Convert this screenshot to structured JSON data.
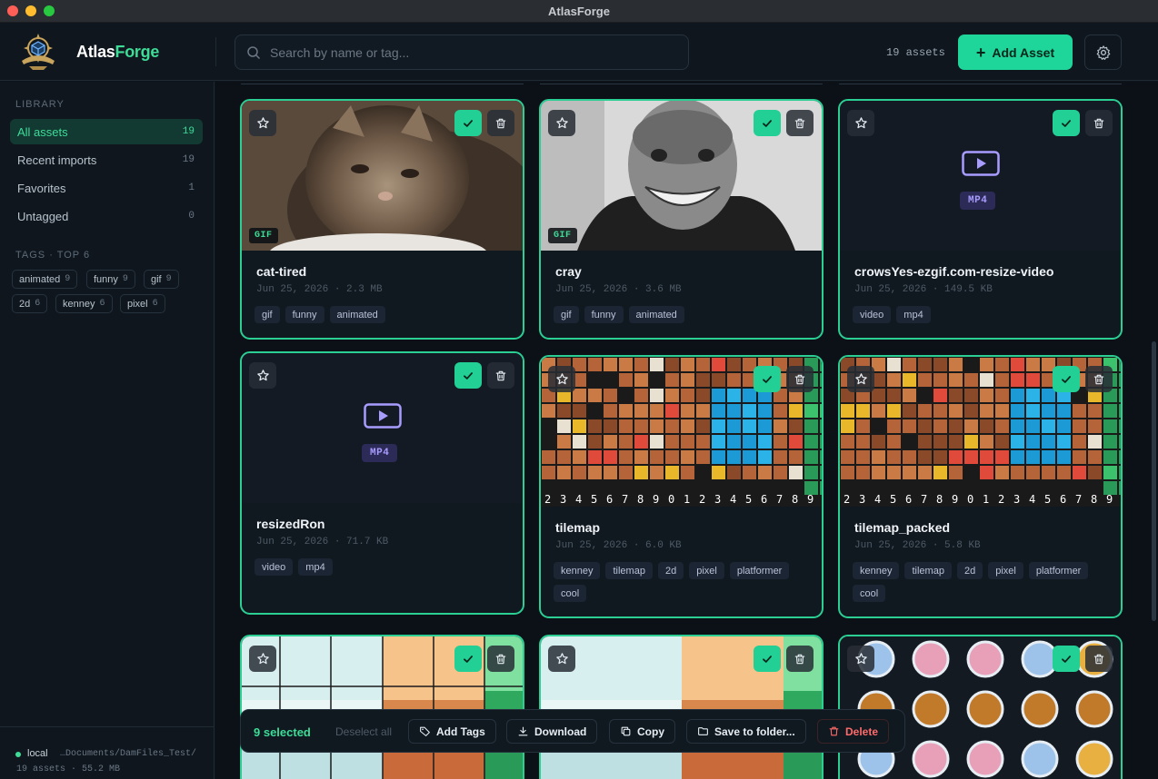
{
  "window": {
    "title": "AtlasForge"
  },
  "brand": {
    "part1": "Atlas",
    "part2": "Forge"
  },
  "search": {
    "placeholder": "Search by name or tag..."
  },
  "header": {
    "asset_count": "19 assets",
    "add_label": "Add Asset"
  },
  "sidebar": {
    "library_label": "LIBRARY",
    "items": [
      {
        "label": "All assets",
        "count": "19"
      },
      {
        "label": "Recent imports",
        "count": "19"
      },
      {
        "label": "Favorites",
        "count": "1"
      },
      {
        "label": "Untagged",
        "count": "0"
      }
    ],
    "tags_label": "TAGS · TOP 6",
    "tags": [
      {
        "label": "animated",
        "count": "9"
      },
      {
        "label": "funny",
        "count": "9"
      },
      {
        "label": "gif",
        "count": "9"
      },
      {
        "label": "2d",
        "count": "6"
      },
      {
        "label": "kenney",
        "count": "6"
      },
      {
        "label": "pixel",
        "count": "6"
      }
    ],
    "footer": {
      "mode": "local",
      "path": "…Documents/DamFiles_Test/",
      "stats": "19 assets · 55.2 MB"
    }
  },
  "cards": [
    {
      "name": "cat-tired",
      "meta": "Jun 25, 2026 · 2.3 MB",
      "badge": "GIF",
      "tags": [
        "gif",
        "funny",
        "animated"
      ]
    },
    {
      "name": "cray",
      "meta": "Jun 25, 2026 · 3.6 MB",
      "badge": "GIF",
      "tags": [
        "gif",
        "funny",
        "animated"
      ]
    },
    {
      "name": "crowsYes-ezgif.com-resize-video",
      "meta": "Jun 25, 2026 · 149.5 KB",
      "badge": "MP4",
      "tags": [
        "video",
        "mp4"
      ]
    },
    {
      "name": "resizedRon",
      "meta": "Jun 25, 2026 · 71.7 KB",
      "badge": "MP4",
      "tags": [
        "video",
        "mp4"
      ]
    },
    {
      "name": "tilemap",
      "meta": "Jun 25, 2026 · 6.0 KB",
      "tags": [
        "kenney",
        "tilemap",
        "2d",
        "pixel",
        "platformer",
        "cool"
      ]
    },
    {
      "name": "tilemap_packed",
      "meta": "Jun 25, 2026 · 5.8 KB",
      "tags": [
        "kenney",
        "tilemap",
        "2d",
        "pixel",
        "platformer",
        "cool"
      ]
    }
  ],
  "actionbar": {
    "selected": "9 selected",
    "deselect": "Deselect all",
    "add_tags": "Add Tags",
    "download": "Download",
    "copy": "Copy",
    "save": "Save to folder...",
    "delete": "Delete"
  },
  "colors": {
    "accent": "#1fd69a",
    "danger": "#ff6b6b",
    "mp4": "#a99cff"
  }
}
